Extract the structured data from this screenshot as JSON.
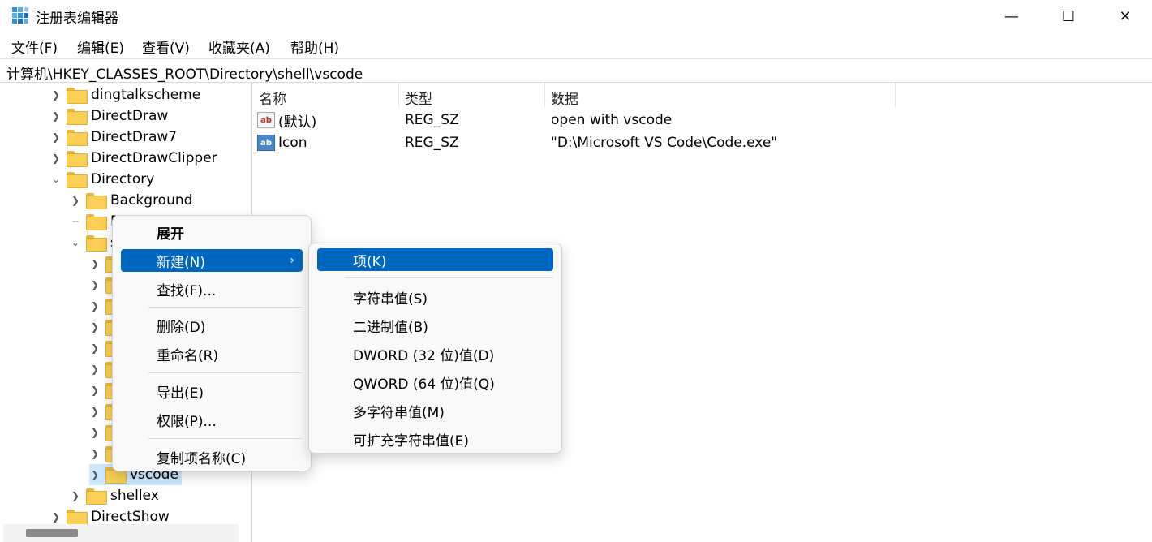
{
  "window": {
    "title": "注册表编辑器",
    "min": "—",
    "max": "☐",
    "close": "✕"
  },
  "menubar": [
    "文件(F)",
    "编辑(E)",
    "查看(V)",
    "收藏夹(A)",
    "帮助(H)"
  ],
  "address": "计算机\\HKEY_CLASSES_ROOT\\Directory\\shell\\vscode",
  "tree": {
    "dingtalkscheme": "dingtalkscheme",
    "directdraw": "DirectDraw",
    "directdraw7": "DirectDraw7",
    "directdrawclipper": "DirectDrawClipper",
    "directory": "Directory",
    "background": "Background",
    "d_partial": "D",
    "s_partial": "s",
    "vscode": "vscode",
    "shellex": "shellex",
    "directshow": "DirectShow"
  },
  "columns": {
    "name": "名称",
    "type": "类型",
    "data": "数据"
  },
  "values": [
    {
      "name": "(默认)",
      "type": "REG_SZ",
      "data": "open with vscode",
      "icon": "ab-string-icon"
    },
    {
      "name": "Icon",
      "type": "REG_SZ",
      "data": "\"D:\\Microsoft VS Code\\Code.exe\"",
      "icon": "ab-string-icon"
    }
  ],
  "context_menu": {
    "expand": "展开",
    "new": "新建(N)",
    "find": "查找(F)...",
    "delete": "删除(D)",
    "rename": "重命名(R)",
    "export": "导出(E)",
    "permissions": "权限(P)...",
    "copy_key_name": "复制项名称(C)"
  },
  "submenu": {
    "key": "项(K)",
    "string": "字符串值(S)",
    "binary": "二进制值(B)",
    "dword": "DWORD (32 位)值(D)",
    "qword": "QWORD (64 位)值(Q)",
    "multi_string": "多字符串值(M)",
    "expand_string": "可扩充字符串值(E)"
  },
  "colors": {
    "highlight": "#0067c0",
    "folder": "#f9cf55",
    "selected_bg": "#cce8ff"
  }
}
